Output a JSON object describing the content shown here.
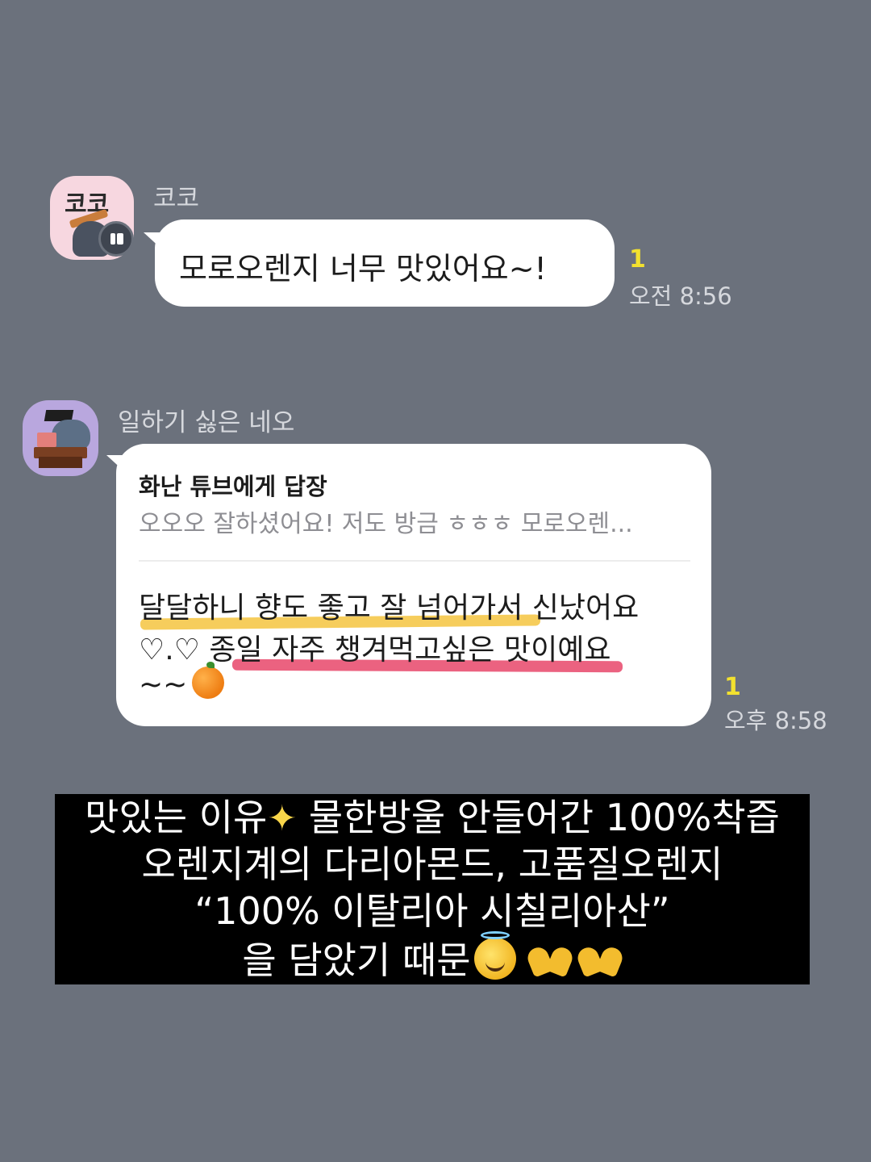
{
  "messages": [
    {
      "sender": "코코",
      "avatar_text": "코코",
      "text": "모로오렌지 너무 맛있어요~!",
      "unread": "1",
      "time": "오전 8:56"
    },
    {
      "sender": "일하기 싫은 네오",
      "reply_to": {
        "title": "화난 튜브에게 답장",
        "snippet": "오오오 잘하셨어요! 저도 방금 ㅎㅎㅎ 모로오렌..."
      },
      "lines": [
        "달달하니 향도 좋고 잘 넘어가서 신났어요",
        "♡.♡  종일 자주 챙겨먹고싶은 맛이예요",
        "~~"
      ],
      "unread": "1",
      "time": "오후 8:58"
    }
  ],
  "caption": {
    "line1_a": "맛있는 이유",
    "line1_b": " 물한방울 안들어간 100%착즙",
    "line2": "오렌지계의 다리아몬드, 고품질오렌지",
    "line3": "“100% 이탈리아 시칠리아산”",
    "line4": "을 담았기 때문"
  },
  "icons": {
    "orange": "tangerine-icon",
    "sparkles": "sparkles-icon",
    "halo": "smiling-face-with-halo-icon",
    "heart_hands": "heart-hands-icon"
  },
  "colors": {
    "background": "#6b717c",
    "unread": "#f2e12f",
    "highlight_yellow": "#f5c84a",
    "highlight_pink": "#ea5a79"
  }
}
